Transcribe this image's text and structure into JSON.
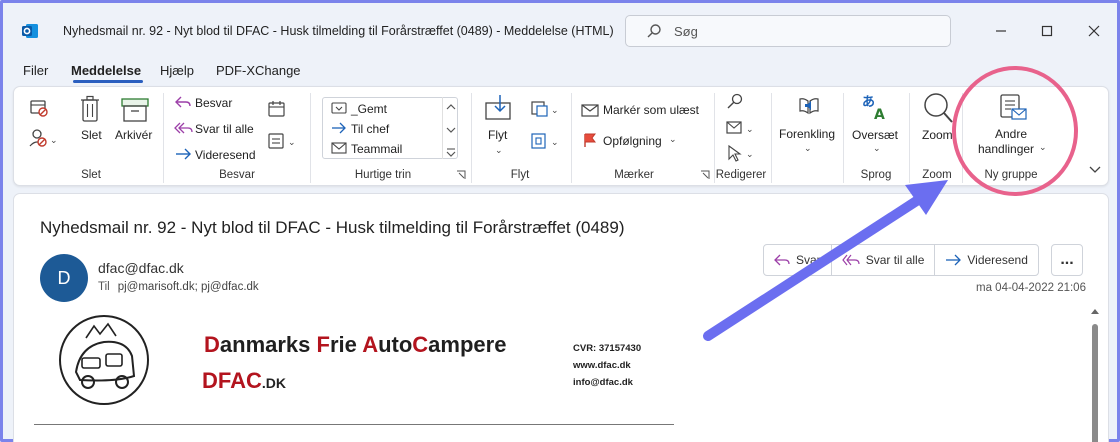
{
  "window": {
    "title": "Nyhedsmail nr. 92 - Nyt blod til DFAC - Husk tilmelding til Forårstræffet    (0489)  -  Meddelelse (HTML)",
    "search_placeholder": "Søg"
  },
  "menu": {
    "items": [
      "Filer",
      "Meddelelse",
      "Hjælp",
      "PDF-XChange"
    ],
    "active": "Meddelelse"
  },
  "ribbon": {
    "slet": {
      "delete": "Slet",
      "archive": "Arkivér",
      "group": "Slet"
    },
    "besvar": {
      "reply": "Besvar",
      "reply_all": "Svar til alle",
      "forward": "Videresend",
      "group": "Besvar"
    },
    "hurtige_trin": {
      "items": [
        "_Gemt",
        "Til chef",
        "Teammail"
      ],
      "group": "Hurtige trin"
    },
    "flyt": {
      "move": "Flyt",
      "group": "Flyt"
    },
    "maerker": {
      "mark_unread": "Markér som ulæst",
      "followup": "Opfølgning",
      "group": "Mærker"
    },
    "redigerer": {
      "group": "Redigerer"
    },
    "forenkling": {
      "label": "Forenkling"
    },
    "sprog": {
      "translate": "Oversæt",
      "group": "Sprog"
    },
    "zoom": {
      "label": "Zoom",
      "group": "Zoom"
    },
    "ny_gruppe": {
      "label_line1": "Andre",
      "label_line2": "handlinger",
      "group": "Ny gruppe"
    }
  },
  "message": {
    "subject": "Nyhedsmail nr. 92 - Nyt blod til DFAC - Husk tilmelding til Forårstræffet    (0489)",
    "avatar_letter": "D",
    "sender": "dfac@dfac.dk",
    "to_label": "Til",
    "to": "pj@marisoft.dk; pj@dfac.dk",
    "datetime": "ma 04-04-2022 21:06",
    "actions": {
      "reply": "Svar",
      "reply_all": "Svar til alle",
      "forward": "Videresend",
      "more": "..."
    }
  },
  "body": {
    "org_name_parts": [
      {
        "t": "D",
        "red": true
      },
      {
        "t": "anmarks ",
        "red": false
      },
      {
        "t": "F",
        "red": true
      },
      {
        "t": "rie ",
        "red": false
      },
      {
        "t": "A",
        "red": true
      },
      {
        "t": "uto",
        "red": false
      },
      {
        "t": "C",
        "red": true
      },
      {
        "t": "ampere",
        "red": false
      }
    ],
    "domain_main": "DFAC",
    "domain_suffix": ".DK",
    "info": [
      "CVR: 37157430",
      "www.dfac.dk",
      "info@dfac.dk"
    ]
  },
  "colors": {
    "accent": "#2b5fbf",
    "highlight_circle": "#e8628c",
    "arrow": "#6b6ef0",
    "brand_red": "#b3141e",
    "avatar": "#1d5a96"
  }
}
